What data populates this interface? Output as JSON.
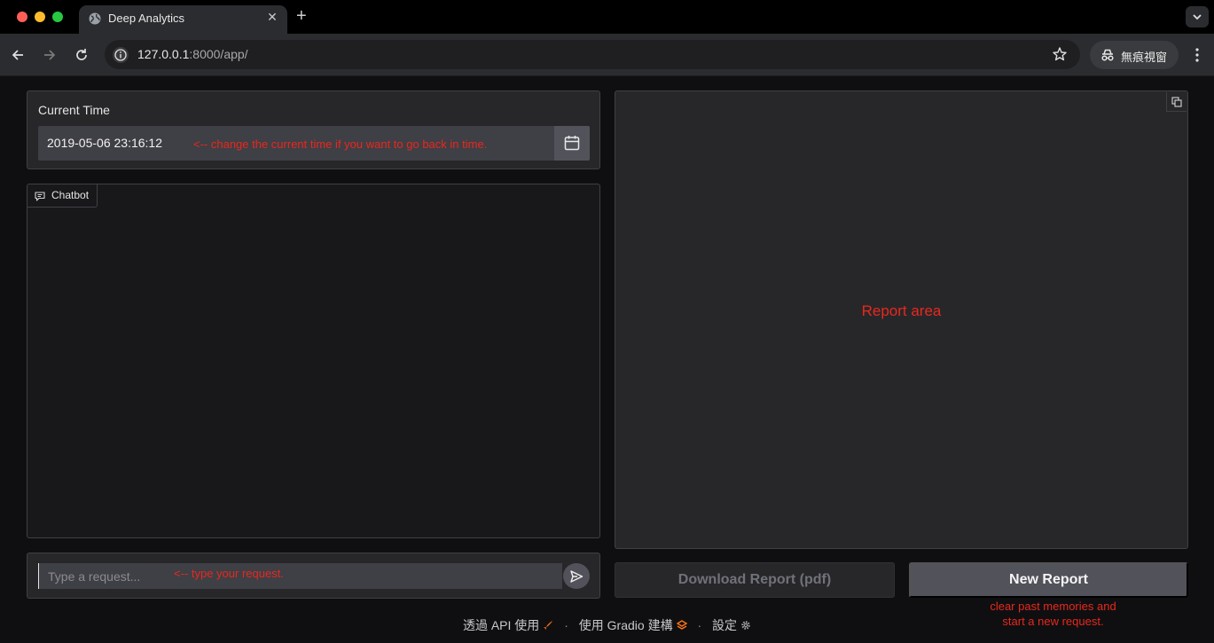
{
  "browser": {
    "tab_title": "Deep Analytics",
    "url_host": "127.0.0.1",
    "url_rest": ":8000/app/",
    "incognito_label": "無痕視窗",
    "tab_close": "✕",
    "new_tab": "+"
  },
  "current_time": {
    "label": "Current Time",
    "value": "2019-05-06 23:16:12",
    "annotation": "<-- change the current time if you want to go back in time."
  },
  "chatbot": {
    "tab_label": "Chatbot"
  },
  "request": {
    "placeholder": "Type a request...",
    "annotation": "<-- type your request."
  },
  "report": {
    "annotation": "Report area"
  },
  "buttons": {
    "download_label": "Download Report (pdf)",
    "new_label": "New Report",
    "new_annotation_line1": "clear past memories and",
    "new_annotation_line2": "start a new request."
  },
  "footer": {
    "api_label": "透過 API 使用",
    "gradio_label": "使用 Gradio 建構",
    "settings_label": "設定",
    "separator": "·"
  },
  "icons": {
    "tab": "globe-icon",
    "calendar": "calendar-icon",
    "send": "send-icon",
    "copy": "copy-icon",
    "chatbot": "chat-bubble-icon"
  },
  "colors": {
    "annotation_red": "#e8281d",
    "panel_bg": "#27272a",
    "app_bg": "#0f0f11"
  }
}
